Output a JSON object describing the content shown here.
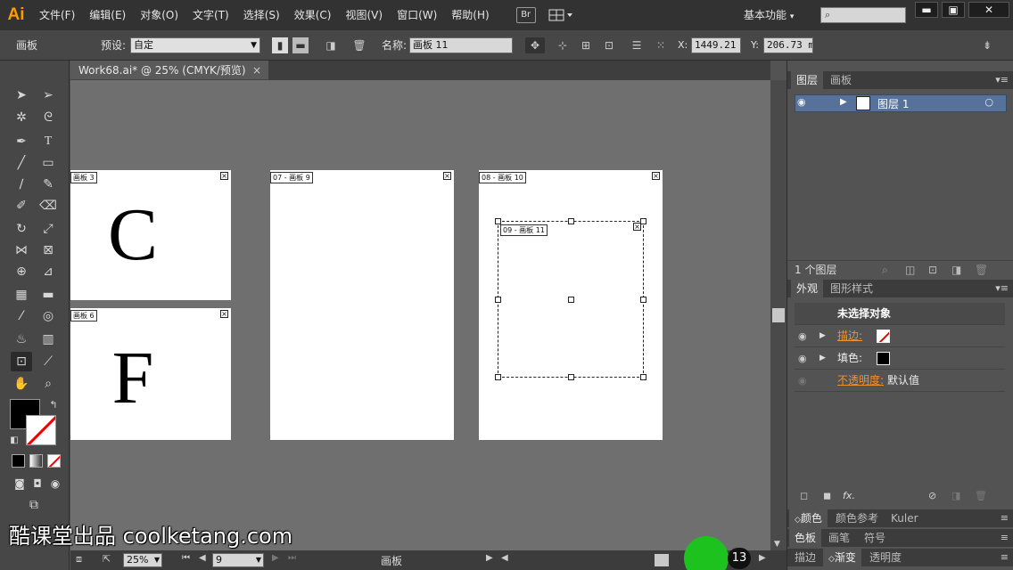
{
  "app": {
    "logo": "Ai"
  },
  "menu": [
    "文件(F)",
    "编辑(E)",
    "对象(O)",
    "文字(T)",
    "选择(S)",
    "效果(C)",
    "视图(V)",
    "窗口(W)",
    "帮助(H)"
  ],
  "bridge_label": "Br",
  "workspace": "基本功能",
  "window_controls": {
    "minimize": "▬",
    "maximize": "▣",
    "close": "✕"
  },
  "control": {
    "tool_name": "画板",
    "preset_label": "预设:",
    "preset_value": "自定",
    "name_label": "名称:",
    "name_value": "画板 11",
    "x_label": "X:",
    "x_value": "1449.21 r",
    "y_label": "Y:",
    "y_value": "206.73 mr"
  },
  "document_tab": {
    "title": "Work68.ai* @ 25% (CMYK/预览)",
    "close": "×"
  },
  "artboards": [
    {
      "tag": "画板 3",
      "letter": "C"
    },
    {
      "tag": "画板 6",
      "letter": "F"
    },
    {
      "tag": "07 - 画板 9",
      "letter": ""
    },
    {
      "tag": "08 - 画板 10",
      "letter": ""
    },
    {
      "tag": "09 - 画板 11",
      "letter": ""
    }
  ],
  "status": {
    "zoom": "25%",
    "page": "9",
    "tool": "画板"
  },
  "layers_panel": {
    "tabs": [
      "图层",
      "画板"
    ],
    "layer_name": "图层 1",
    "footer": "1 个图层"
  },
  "appearance_panel": {
    "tabs": [
      "外观",
      "图形样式"
    ],
    "header": "未选择对象",
    "stroke_label": "描边:",
    "fill_label": "填色:",
    "opacity_label": "不透明度:",
    "opacity_value": "默认值"
  },
  "bottom_panels": {
    "group1": [
      "颜色",
      "颜色参考",
      "Kuler"
    ],
    "group2": [
      "色板",
      "画笔",
      "符号"
    ],
    "group3": [
      "描边",
      "渐变",
      "透明度"
    ]
  },
  "watermark": "酷课堂出品 coolketang.com",
  "overlay_counter": "13"
}
